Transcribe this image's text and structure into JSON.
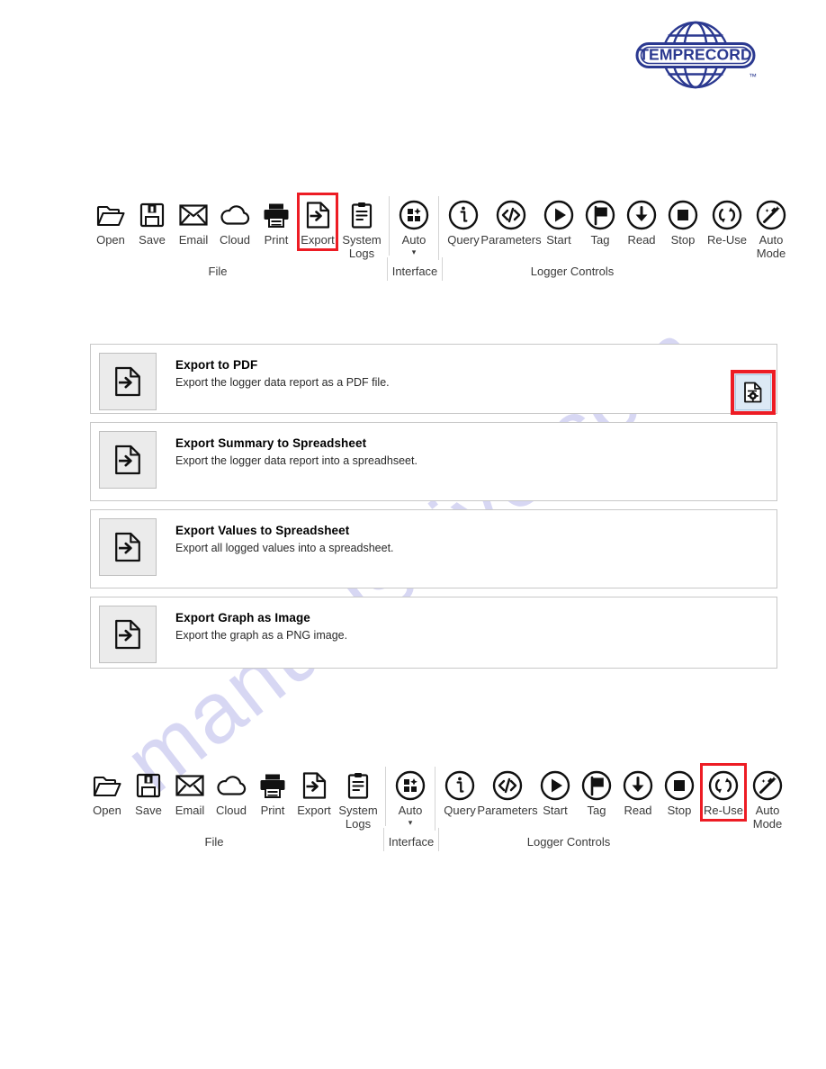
{
  "brand": {
    "logo_text": "TEMPRECORD",
    "logo_tm": "™",
    "logo_color": "#2b3990"
  },
  "watermark": {
    "text": "manualshive.com",
    "color": "#c9c8ef"
  },
  "highlight_color": "#ed1c24",
  "ribbons": [
    {
      "id": "top",
      "groups": [
        {
          "label": "File",
          "buttons": [
            {
              "label": "Open",
              "icon": "open-folder-icon",
              "highlighted": false
            },
            {
              "label": "Save",
              "icon": "floppy-disk-icon",
              "highlighted": false
            },
            {
              "label": "Email",
              "icon": "envelope-icon",
              "highlighted": false
            },
            {
              "label": "Cloud",
              "icon": "cloud-icon",
              "highlighted": false
            },
            {
              "label": "Print",
              "icon": "printer-icon",
              "highlighted": false
            },
            {
              "label": "Export",
              "icon": "export-document-icon",
              "highlighted": true
            },
            {
              "label": "System\nLogs",
              "icon": "clipboard-icon",
              "highlighted": false
            }
          ]
        },
        {
          "label": "Interface",
          "buttons": [
            {
              "label": "Auto",
              "icon": "auto-interface-icon",
              "highlighted": false,
              "caret": "▾"
            }
          ]
        },
        {
          "label": "Logger Controls",
          "buttons": [
            {
              "label": "Query",
              "icon": "info-circle-icon",
              "highlighted": false
            },
            {
              "label": "Parameters",
              "icon": "code-circle-icon",
              "highlighted": false
            },
            {
              "label": "Start",
              "icon": "play-circle-icon",
              "highlighted": false
            },
            {
              "label": "Tag",
              "icon": "flag-circle-icon",
              "highlighted": false
            },
            {
              "label": "Read",
              "icon": "download-circle-icon",
              "highlighted": false
            },
            {
              "label": "Stop",
              "icon": "stop-circle-icon",
              "highlighted": false
            },
            {
              "label": "Re-Use",
              "icon": "refresh-circle-icon",
              "highlighted": false
            },
            {
              "label": "Auto\nMode",
              "icon": "magic-wand-circle-icon",
              "highlighted": false
            }
          ]
        }
      ]
    },
    {
      "id": "bottom",
      "groups": [
        {
          "label": "File",
          "buttons": [
            {
              "label": "Open",
              "icon": "open-folder-icon",
              "highlighted": false
            },
            {
              "label": "Save",
              "icon": "floppy-disk-icon",
              "highlighted": false
            },
            {
              "label": "Email",
              "icon": "envelope-icon",
              "highlighted": false
            },
            {
              "label": "Cloud",
              "icon": "cloud-icon",
              "highlighted": false
            },
            {
              "label": "Print",
              "icon": "printer-icon",
              "highlighted": false
            },
            {
              "label": "Export",
              "icon": "export-document-icon",
              "highlighted": false
            },
            {
              "label": "System\nLogs",
              "icon": "clipboard-icon",
              "highlighted": false
            }
          ]
        },
        {
          "label": "Interface",
          "buttons": [
            {
              "label": "Auto",
              "icon": "auto-interface-icon",
              "highlighted": false,
              "caret": "▾"
            }
          ]
        },
        {
          "label": "Logger Controls",
          "buttons": [
            {
              "label": "Query",
              "icon": "info-circle-icon",
              "highlighted": false
            },
            {
              "label": "Parameters",
              "icon": "code-circle-icon",
              "highlighted": false
            },
            {
              "label": "Start",
              "icon": "play-circle-icon",
              "highlighted": false
            },
            {
              "label": "Tag",
              "icon": "flag-circle-icon",
              "highlighted": false
            },
            {
              "label": "Read",
              "icon": "download-circle-icon",
              "highlighted": false
            },
            {
              "label": "Stop",
              "icon": "stop-circle-icon",
              "highlighted": false
            },
            {
              "label": "Re-Use",
              "icon": "refresh-circle-icon",
              "highlighted": true
            },
            {
              "label": "Auto\nMode",
              "icon": "magic-wand-circle-icon",
              "highlighted": false
            }
          ]
        }
      ]
    }
  ],
  "export_list": {
    "items": [
      {
        "title": "Export to PDF",
        "desc": "Export the logger data report as a PDF file.",
        "icon": "export-document-icon"
      },
      {
        "title": "Export Summary to Spreadsheet",
        "desc": "Export the logger data report into a spreadhseet.",
        "icon": "export-document-icon"
      },
      {
        "title": "Export Values to Spreadsheet",
        "desc": "Export all logged values into a spreadsheet.",
        "icon": "export-document-icon"
      },
      {
        "title": "Export Graph as Image",
        "desc": "Export the graph as a PNG image.",
        "icon": "export-document-icon"
      }
    ]
  },
  "pdf_settings_button": {
    "icon": "document-gear-icon",
    "highlighted": true
  }
}
